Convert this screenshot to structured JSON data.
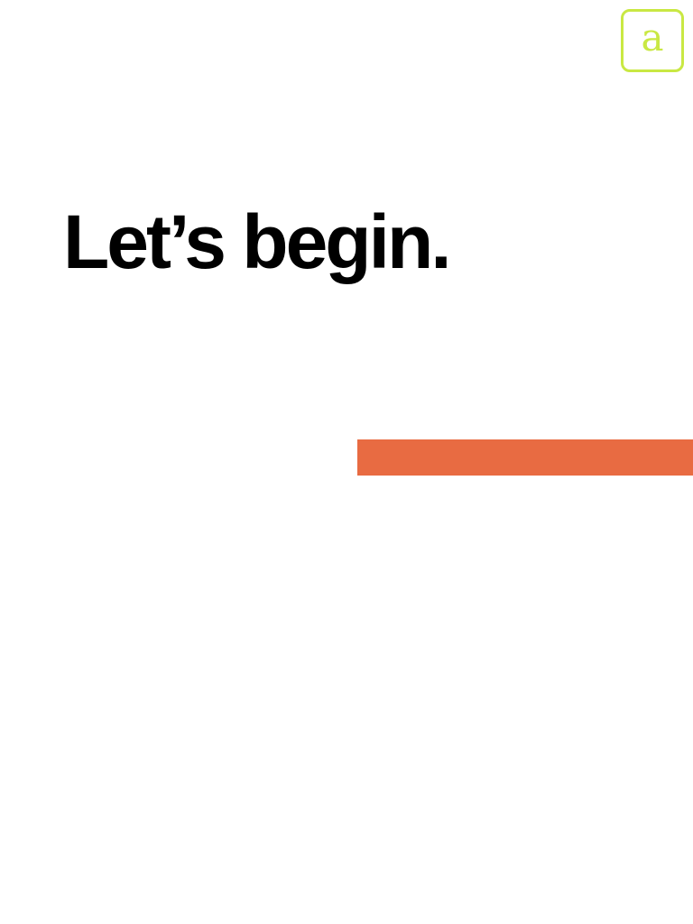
{
  "logo": {
    "letter": "a",
    "color": "#c9e843"
  },
  "heading": {
    "text": "Let’s begin."
  },
  "accent_bar": {
    "color": "#e86b42"
  }
}
